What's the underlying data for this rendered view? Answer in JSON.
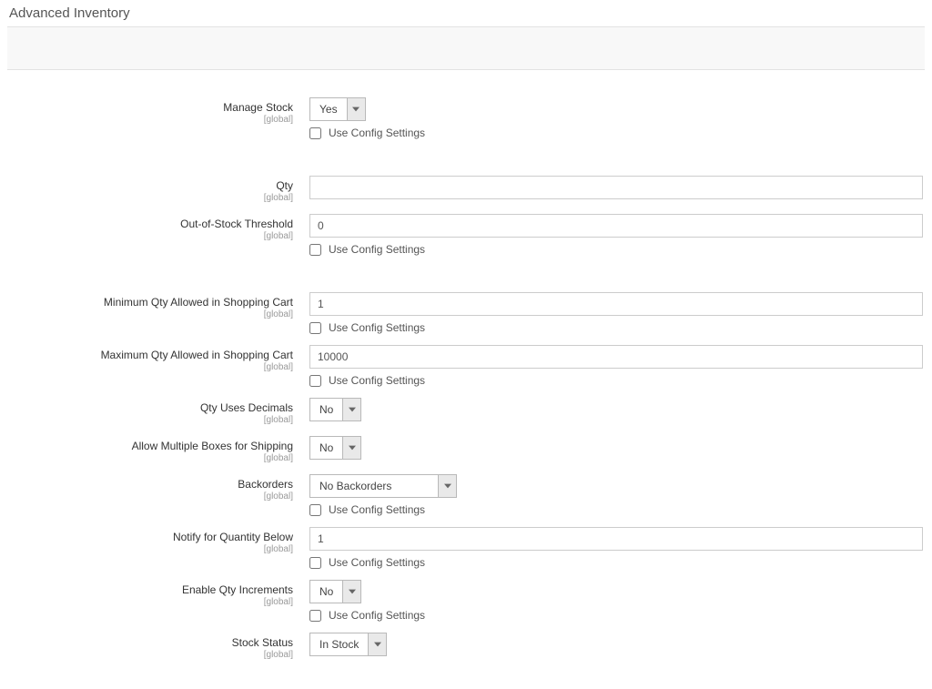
{
  "title": "Advanced Inventory",
  "scope": "[global]",
  "config_label": "Use Config Settings",
  "fields": {
    "manage_stock": {
      "label": "Manage Stock",
      "value": "Yes"
    },
    "qty": {
      "label": "Qty",
      "value": ""
    },
    "oos_threshold": {
      "label": "Out-of-Stock Threshold",
      "value": "0"
    },
    "min_qty": {
      "label": "Minimum Qty Allowed in Shopping Cart",
      "value": "1"
    },
    "max_qty": {
      "label": "Maximum Qty Allowed in Shopping Cart",
      "value": "10000"
    },
    "qty_decimals": {
      "label": "Qty Uses Decimals",
      "value": "No"
    },
    "multi_boxes": {
      "label": "Allow Multiple Boxes for Shipping",
      "value": "No"
    },
    "backorders": {
      "label": "Backorders",
      "value": "No Backorders"
    },
    "notify_below": {
      "label": "Notify for Quantity Below",
      "value": "1"
    },
    "qty_incr": {
      "label": "Enable Qty Increments",
      "value": "No"
    },
    "stock_status": {
      "label": "Stock Status",
      "value": "In Stock"
    }
  }
}
